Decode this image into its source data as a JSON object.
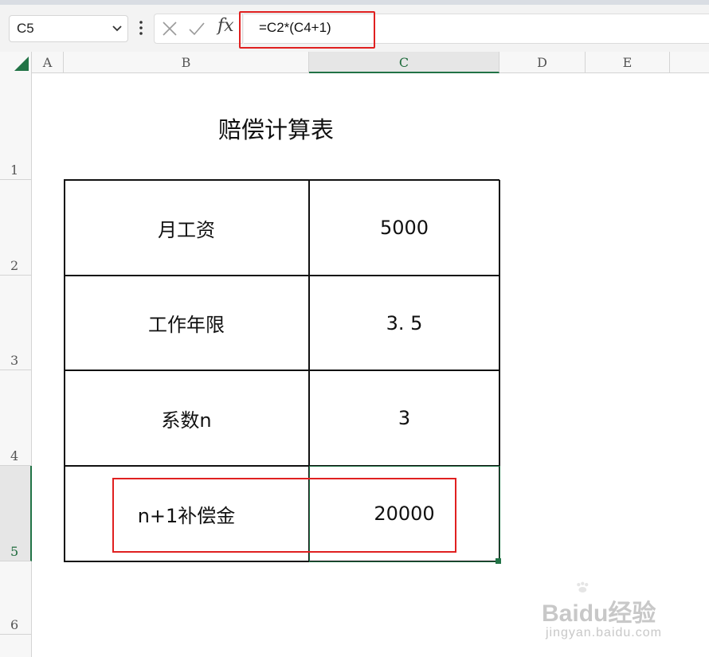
{
  "formula_bar": {
    "name_box": "C5",
    "formula": "=C2*(C4+1)"
  },
  "columns": [
    "A",
    "B",
    "C",
    "D",
    "E"
  ],
  "rows": [
    "1",
    "2",
    "3",
    "4",
    "5",
    "6"
  ],
  "sheet": {
    "title": "赔偿计算表",
    "table": [
      {
        "label": "月工资",
        "value": "5000"
      },
      {
        "label": "工作年限",
        "value": "3. 5"
      },
      {
        "label": "系数n",
        "value": "3"
      },
      {
        "label": "n+1补偿金",
        "value": "20000"
      }
    ]
  },
  "watermark": {
    "brand_a": "Bai",
    "brand_b": "du",
    "brand_c": "经验",
    "url": "jingyan.baidu.com"
  },
  "colors": {
    "selection": "#217346",
    "highlight": "#e02020"
  }
}
